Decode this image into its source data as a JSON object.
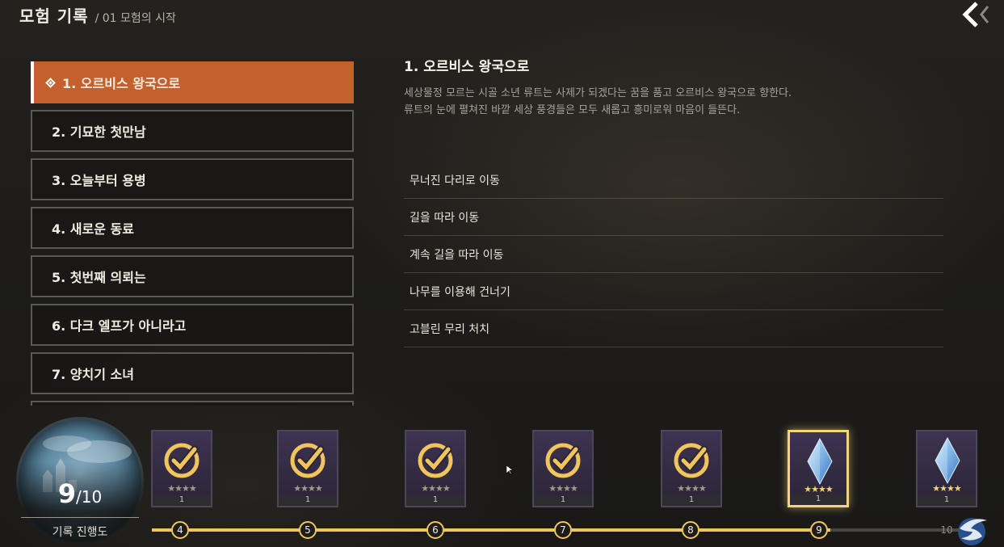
{
  "header": {
    "title": "모험 기록",
    "breadcrumb": "/ 01 모험의 시작"
  },
  "chapters": [
    {
      "label": "1. 오르비스 왕국으로",
      "active": true
    },
    {
      "label": "2. 기묘한 첫만남"
    },
    {
      "label": "3. 오늘부터 용병"
    },
    {
      "label": "4. 새로운 동료"
    },
    {
      "label": "5. 첫번째 의뢰는"
    },
    {
      "label": "6. 다크 엘프가 아니라고"
    },
    {
      "label": "7. 양치기 소녀"
    }
  ],
  "detail": {
    "heading": "1. 오르비스 왕국으로",
    "desc_line1": "세상물정 모르는 시골 소년 류트는 사제가 되겠다는 꿈을 품고 오르비스 왕국으로 향한다.",
    "desc_line2": "류트의 눈에 펼쳐진 바깥 세상 풍경들은 모두 새롭고 흥미로워 마음이 들뜬다.",
    "objectives": [
      "무너진 다리로 이동",
      "길을 따라 이동",
      "계속 길을 따라 이동",
      "나무를 이용해 건너기",
      "고블린 무리 처치"
    ]
  },
  "progress": {
    "current": "9",
    "total": "/10",
    "label": "기록 진행도"
  },
  "rewards": [
    {
      "icon": "check-badge-icon",
      "stars": "★★★★",
      "qty": "1",
      "claimed": true
    },
    {
      "icon": "check-badge-icon",
      "stars": "★★★★",
      "qty": "1",
      "claimed": true
    },
    {
      "icon": "check-badge-icon",
      "stars": "★★★★",
      "qty": "1",
      "claimed": true
    },
    {
      "icon": "check-badge-icon",
      "stars": "★★★★",
      "qty": "1",
      "claimed": true
    },
    {
      "icon": "check-badge-icon",
      "stars": "★★★★",
      "qty": "1",
      "claimed": true
    },
    {
      "icon": "blue-crystal-icon",
      "stars": "★★★★",
      "qty": "1",
      "claimed": false,
      "highlight": true
    },
    {
      "icon": "blue-crystal-icon",
      "stars": "★★★★",
      "qty": "1",
      "claimed": false
    }
  ],
  "milestones": [
    "4",
    "5",
    "6",
    "7",
    "8",
    "9",
    "10"
  ],
  "milestone_progress": 0.84,
  "colors": {
    "accent": "#c4602e",
    "gold": "#f0c65c",
    "card_bg": "#3e3352"
  }
}
